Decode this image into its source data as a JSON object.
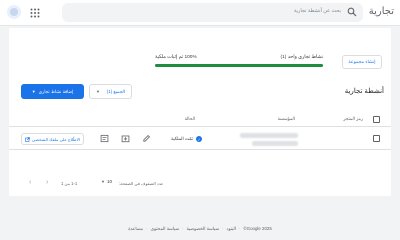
{
  "app": {
    "title": "تجارية"
  },
  "search": {
    "placeholder": "بحث عن أنشطة تجارية"
  },
  "setup_button": {
    "label": "إنشاء مجموعة"
  },
  "progress": {
    "verified_label": "نشاط تجاري واحد (1)",
    "complete_label": "100% تم إثبات ملكية",
    "fraction": 1.0
  },
  "section": {
    "title": "أنشطة تجارية"
  },
  "add_button": {
    "label": "إضافة نشاط تجاري"
  },
  "filter": {
    "label": "الجميع (1)"
  },
  "table": {
    "headers": {
      "code": "رمز المتجر",
      "business": "المؤسسة",
      "status": "الحالة"
    },
    "row": {
      "status": "تمّت الملكية",
      "profile_link": "الاطّلاع على ملفك الشخصي"
    }
  },
  "pager": {
    "rows_label": "عدد الصفوف في الصفحة:",
    "rows_value": "10",
    "count": "1-1 من 1"
  },
  "footer": {
    "copyright": "Google 2025©",
    "links": [
      "البنود",
      "سياسة الخصوصية",
      "سياسة المحتوى",
      "مساعدة"
    ]
  },
  "colors": {
    "accent": "#1a73e8",
    "progress": "#1e8e3e"
  }
}
